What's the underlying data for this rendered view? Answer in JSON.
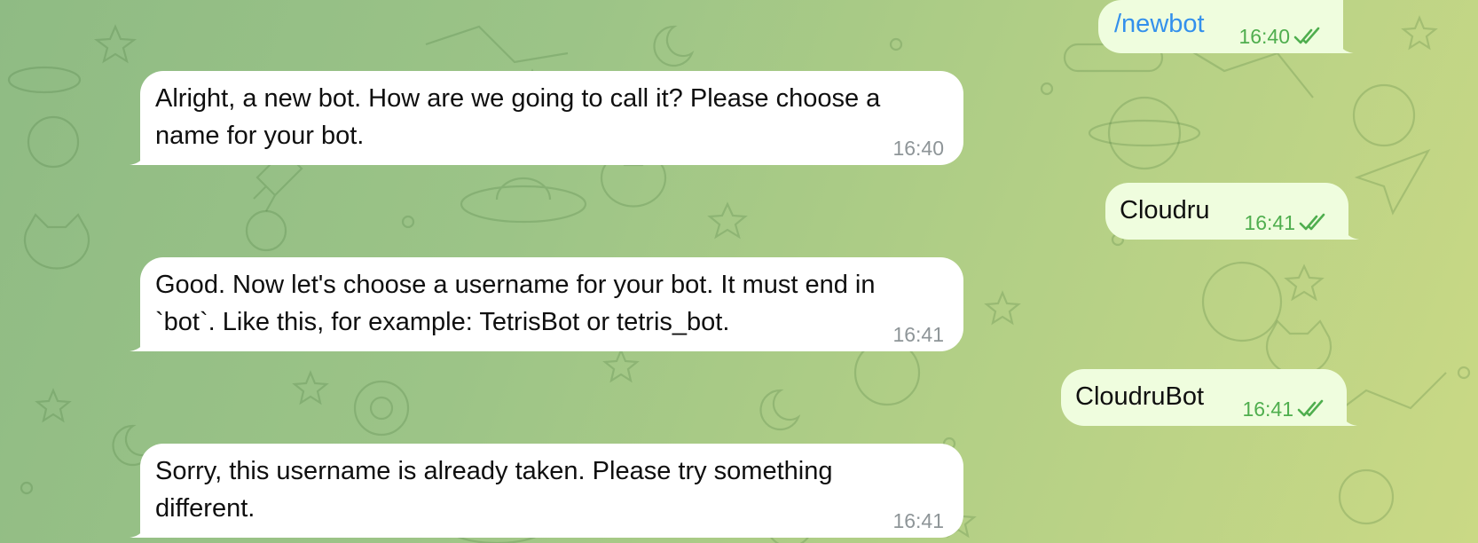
{
  "messages": [
    {
      "dir": "out",
      "text": "/newbot",
      "time": "16:40",
      "is_command": true
    },
    {
      "dir": "in",
      "line1": "Alright, a new bot. How are we going to call it? Please choose a",
      "line2": "name for your bot.",
      "time": "16:40"
    },
    {
      "dir": "out",
      "text": "Cloudru",
      "time": "16:41"
    },
    {
      "dir": "in",
      "line1": "Good. Now let's choose a username for your bot. It must end in",
      "line2": "`bot`. Like this, for example: TetrisBot or tetris_bot.",
      "time": "16:41"
    },
    {
      "dir": "out",
      "text": "CloudruBot",
      "time": "16:41"
    },
    {
      "dir": "in",
      "line1": "Sorry, this username is already taken. Please try something",
      "line2": "different.",
      "time": "16:41"
    }
  ],
  "colors": {
    "incoming_bubble": "#ffffff",
    "outgoing_bubble": "#effdde",
    "outgoing_meta": "#4fae4e",
    "incoming_meta": "#8e9598",
    "command_link": "#3390ec"
  },
  "icons": {
    "read_receipt": "double-check-icon"
  }
}
